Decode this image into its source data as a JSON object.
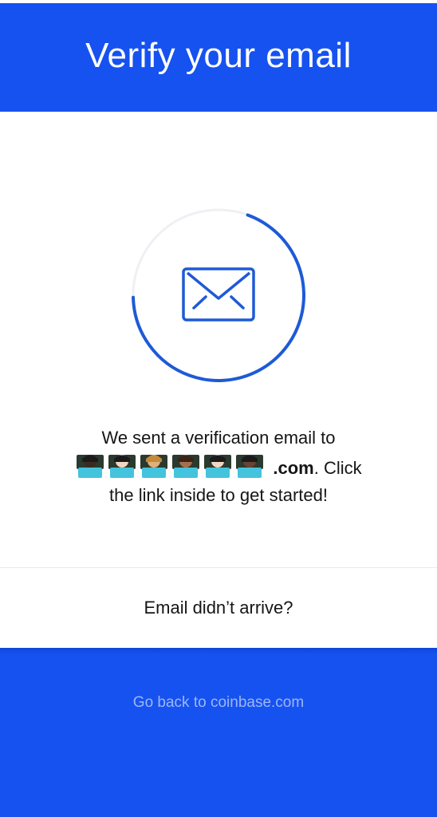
{
  "header": {
    "title": "Verify your email"
  },
  "status": {
    "icon": "mail-icon",
    "ring_progress": 0.69,
    "accent_color": "#1e5ad6",
    "track_color": "#eef0f3"
  },
  "message": {
    "line1": "We sent a verification email to",
    "email_domain": ".com",
    "line2_suffix": ". Click",
    "line3": "the link inside to get started!"
  },
  "resend": {
    "label": "Email didn’t arrive?"
  },
  "footer": {
    "link_label": "Go back to coinbase.com",
    "background": "#1652f0"
  }
}
